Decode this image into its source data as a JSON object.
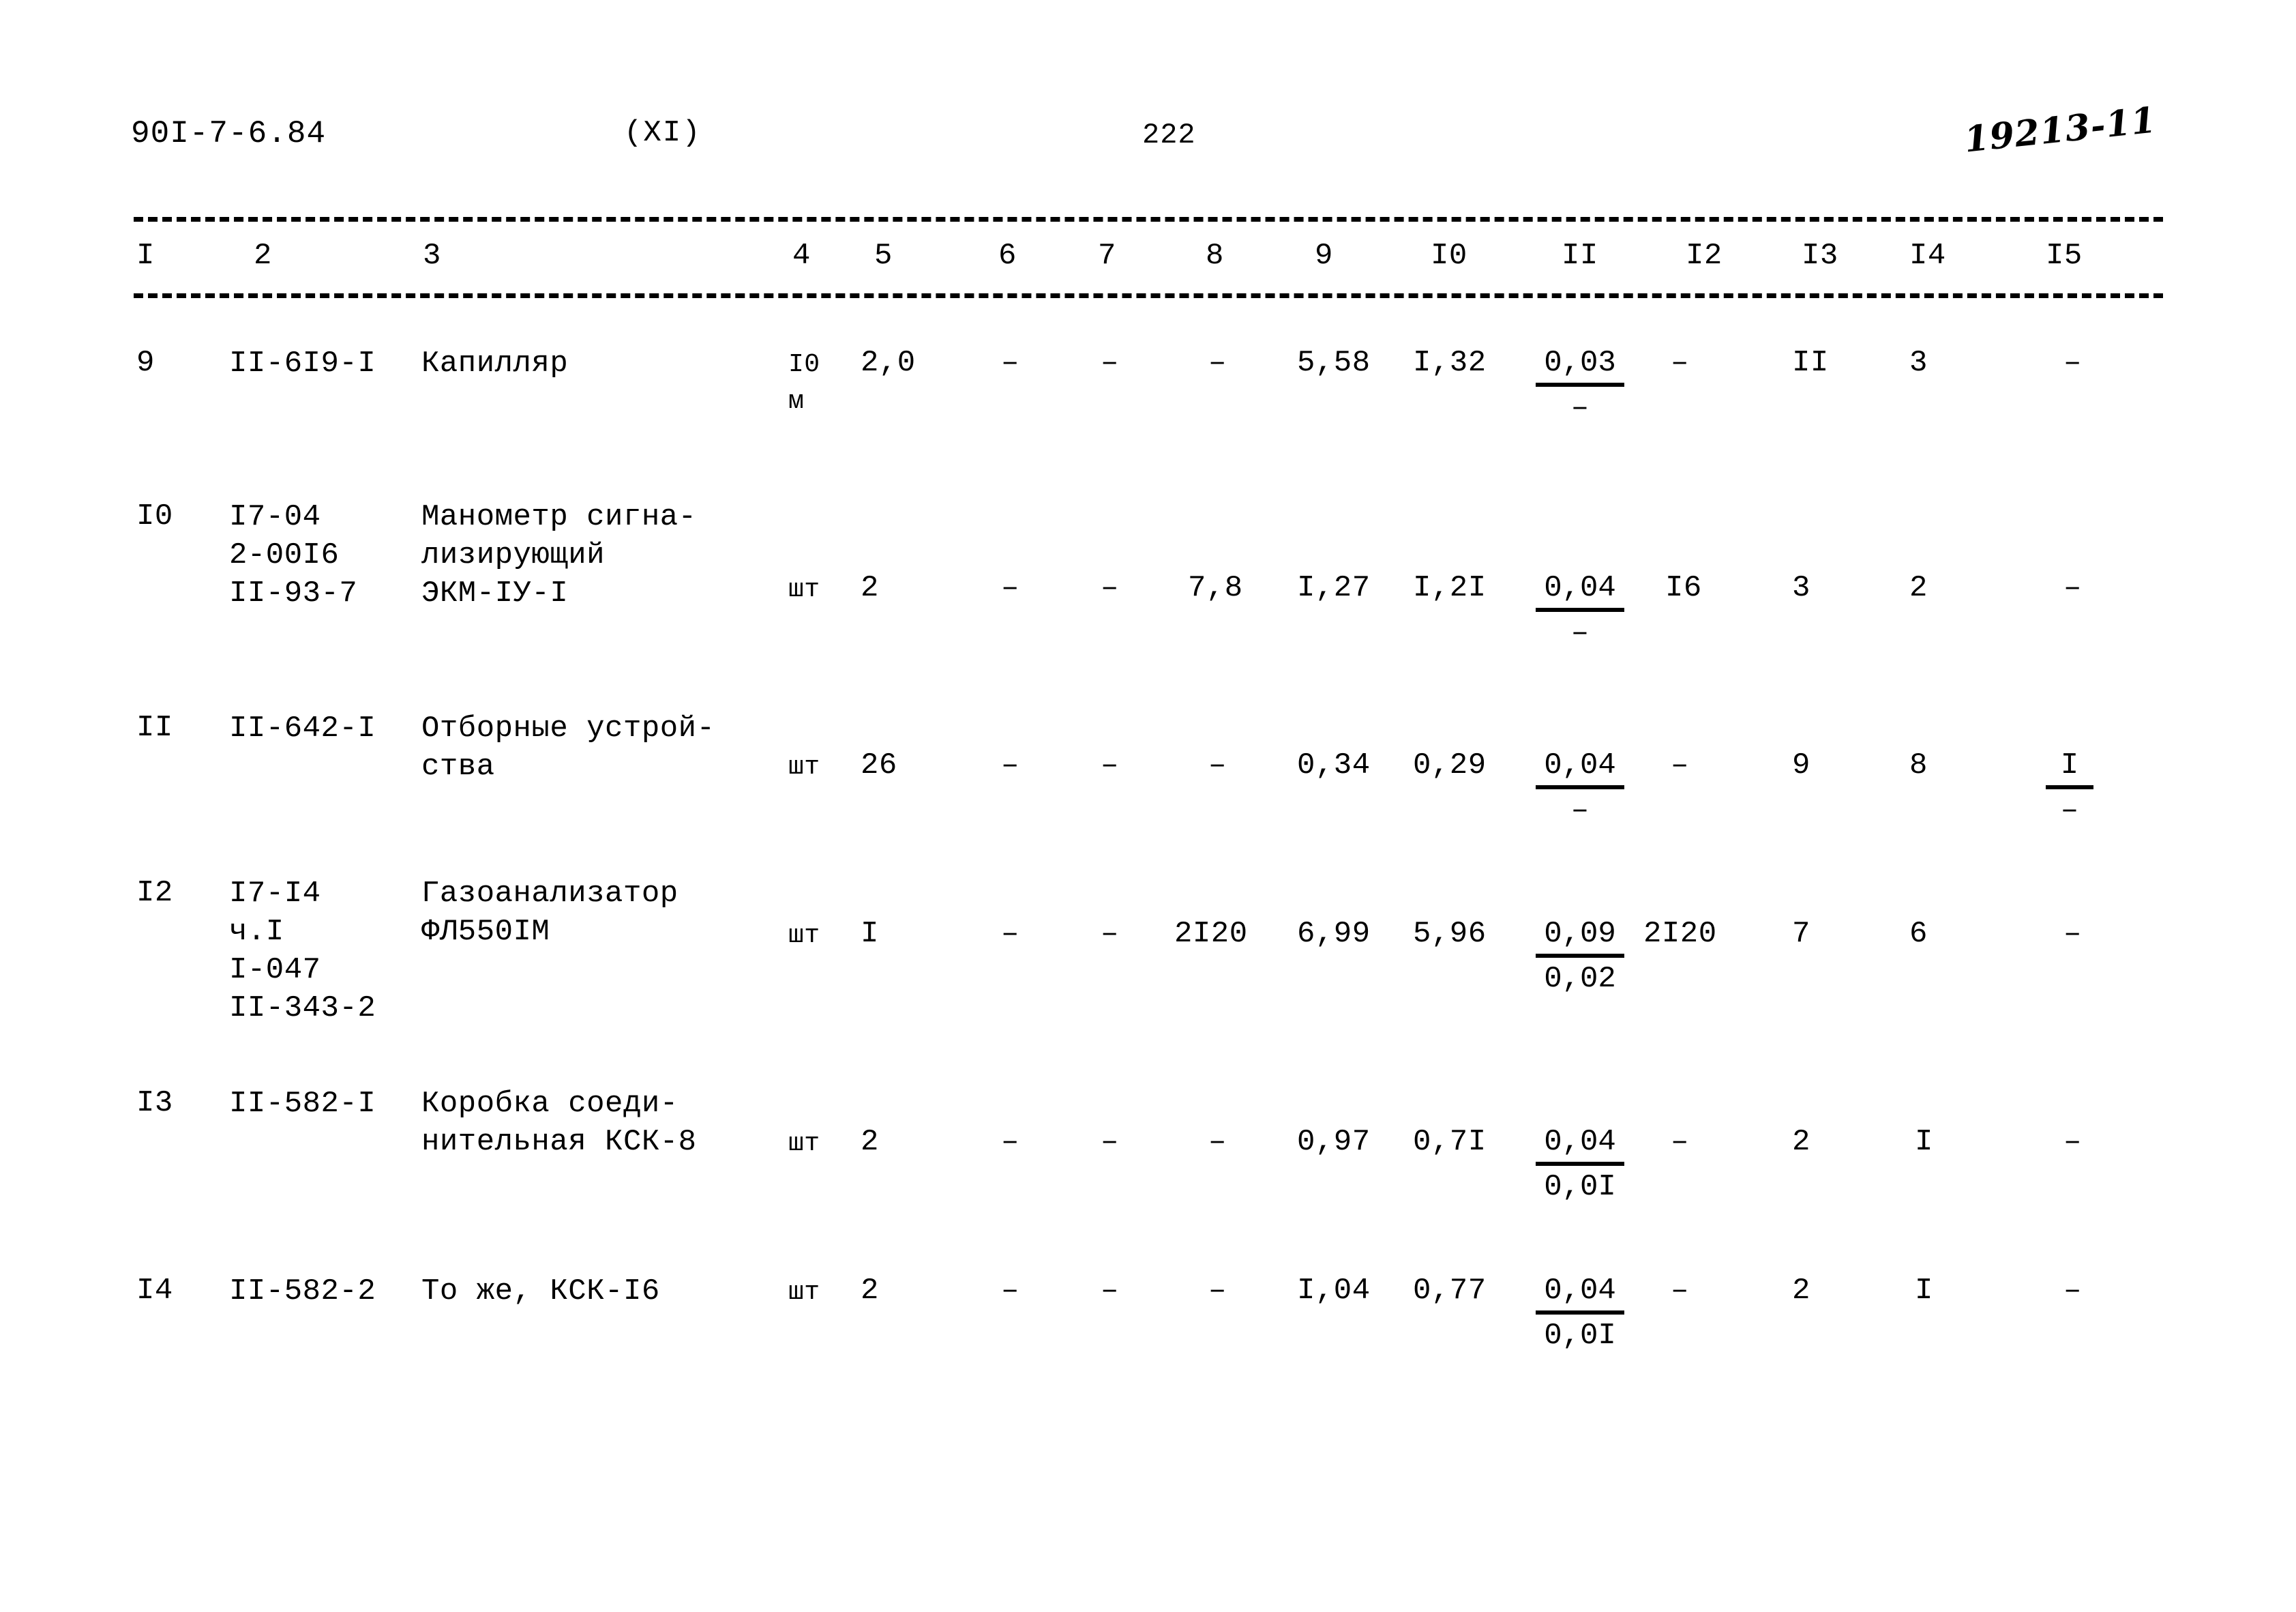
{
  "header": {
    "doc_code": "90I-7-6.84",
    "section": "(XI)",
    "page_number": "222",
    "handwritten_note": "19213-11"
  },
  "table": {
    "column_headers": [
      "I",
      "2",
      "3",
      "4",
      "5",
      "6",
      "7",
      "8",
      "9",
      "I0",
      "II",
      "I2",
      "I3",
      "I4",
      "I5"
    ],
    "rows": [
      {
        "num": "9",
        "code": "II-6I9-I",
        "name": "Капилляр",
        "unit": "I0\nм",
        "c5": "2,0",
        "c6": "–",
        "c7": "–",
        "c8": "–",
        "c9": "5,58",
        "c10": "I,32",
        "c11_top": "0,03",
        "c11_bot": "–",
        "c12": "–",
        "c13": "II",
        "c14": "3",
        "c15": "–"
      },
      {
        "num": "I0",
        "code": "I7-04\n2-00I6\nII-93-7",
        "name": "Манометр сигна-\nлизирующий\nЭКМ-IУ-I",
        "unit": "шт",
        "c5": "2",
        "c6": "–",
        "c7": "–",
        "c8": "7,8",
        "c9": "I,27",
        "c10": "I,2I",
        "c11_top": "0,04",
        "c11_bot": "–",
        "c12": "I6",
        "c13": "3",
        "c14": "2",
        "c15": "–"
      },
      {
        "num": "II",
        "code": "II-642-I",
        "name": "Отборные устрой-\nства",
        "unit": "шт",
        "c5": "26",
        "c6": "–",
        "c7": "–",
        "c8": "–",
        "c9": "0,34",
        "c10": "0,29",
        "c11_top": "0,04",
        "c11_bot": "–",
        "c12": "–",
        "c13": "9",
        "c14": "8",
        "c15_top": "I",
        "c15_bot": "–"
      },
      {
        "num": "I2",
        "code": "I7-I4\nч.I\nI-047\nII-343-2",
        "name": "Газоанализатор\nФЛ550IМ",
        "unit": "шт",
        "c5": "I",
        "c6": "–",
        "c7": "–",
        "c8": "2I20",
        "c9": "6,99",
        "c10": "5,96",
        "c11_top": "0,09",
        "c11_bot": "0,02",
        "c12": "2I20",
        "c13": "7",
        "c14": "6",
        "c15": "–"
      },
      {
        "num": "I3",
        "code": "II-582-I",
        "name": "Коробка соеди-\nнительная КСК-8",
        "unit": "шт",
        "c5": "2",
        "c6": "–",
        "c7": "–",
        "c8": "–",
        "c9": "0,97",
        "c10": "0,7I",
        "c11_top": "0,04",
        "c11_bot": "0,0I",
        "c12": "–",
        "c13": "2",
        "c14": "I",
        "c15": "–"
      },
      {
        "num": "I4",
        "code": "II-582-2",
        "name": "То же, КСК-I6",
        "unit": "шт",
        "c5": "2",
        "c6": "–",
        "c7": "–",
        "c8": "–",
        "c9": "I,04",
        "c10": "0,77",
        "c11_top": "0,04",
        "c11_bot": "0,0I",
        "c12": "–",
        "c13": "2",
        "c14": "I",
        "c15": "–"
      }
    ]
  }
}
